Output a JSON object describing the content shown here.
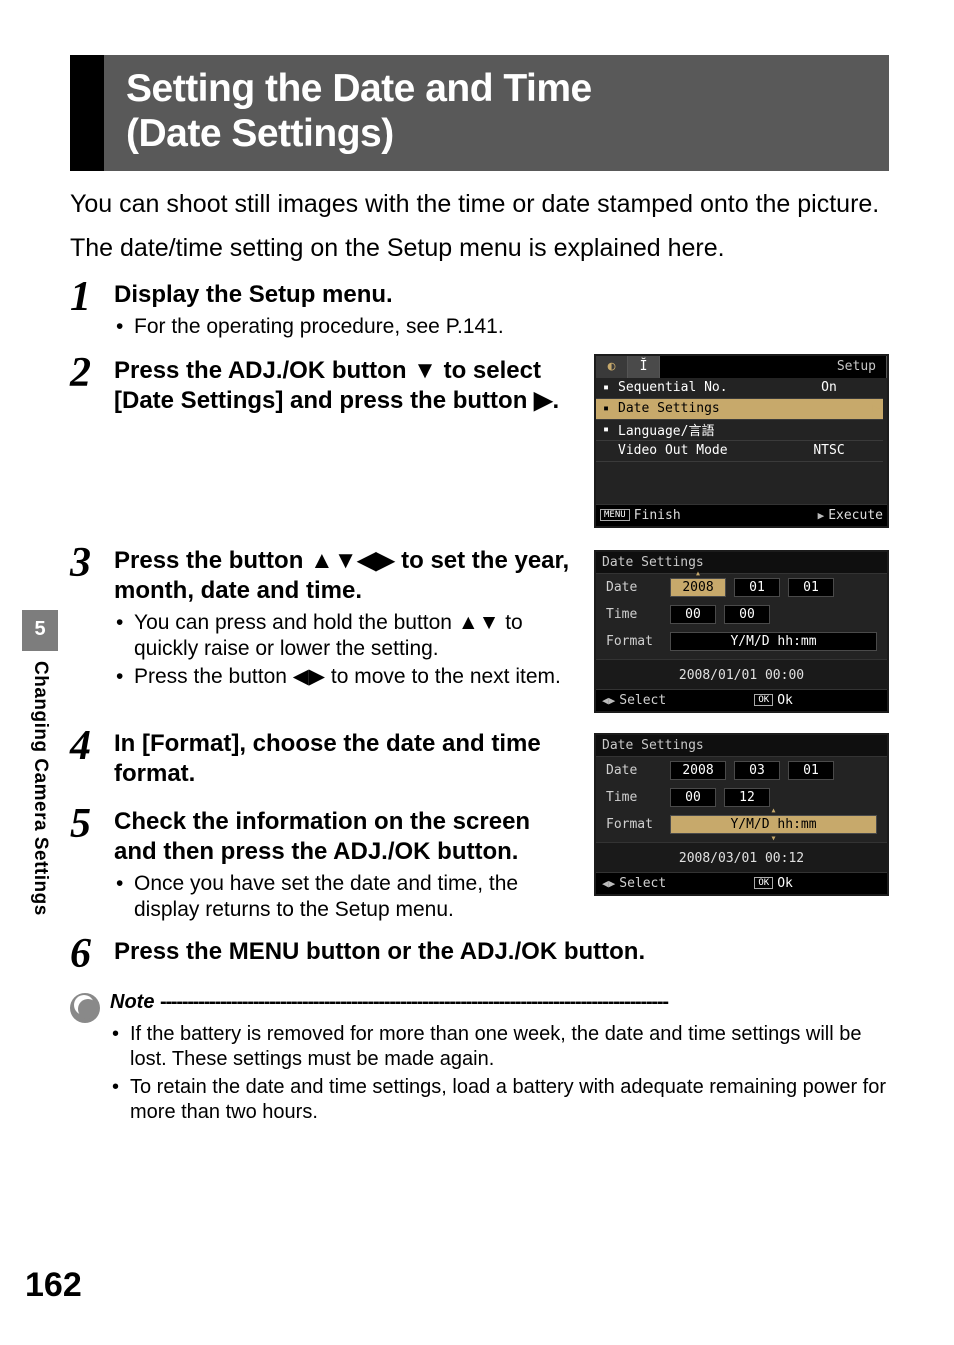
{
  "section": {
    "title_line1": "Setting the Date and Time",
    "title_line2": "(Date Settings)"
  },
  "intro": {
    "p1": "You can shoot still images with the time or date stamped onto the picture.",
    "p2": "The date/time setting on the Setup menu is explained here."
  },
  "steps": {
    "s1": {
      "num": "1",
      "title": "Display the Setup menu.",
      "b1": "For the operating procedure, see P.141."
    },
    "s2": {
      "num": "2",
      "title_a": "Press the ADJ./OK button ",
      "title_b": " to select [Date Settings] and press the button ",
      "arrow_down": "▼",
      "arrow_right": "▶",
      "period": "."
    },
    "s3": {
      "num": "3",
      "title_a": "Press the button ",
      "title_b": " to set the year, month, date and time.",
      "arrows4": "▲▼◀▶",
      "b1_a": "You can press and hold the button ",
      "b1_arrows": "▲▼",
      "b1_b": " to quickly raise or lower the setting.",
      "b2_a": "Press the button ",
      "b2_arrows": "◀▶",
      "b2_b": " to move to the next item."
    },
    "s4": {
      "num": "4",
      "title": "In [Format], choose the date and time format."
    },
    "s5": {
      "num": "5",
      "title": "Check the information on the screen and then press the ADJ./OK button.",
      "b1": "Once you have set the date and time, the display returns to the Setup menu."
    },
    "s6": {
      "num": "6",
      "title": "Press the MENU button or the ADJ./OK button."
    }
  },
  "note": {
    "label": "Note",
    "dashes": "---------------------------------------------------------------------------------------------",
    "b1": "If the battery is removed for more than one week, the date and time settings will be lost. These settings must be made again.",
    "b2": "To retain the date and time settings, load a battery with adequate remaining power for more than two hours."
  },
  "sidebar": {
    "chapter_num": "5",
    "chapter_name": "Changing Camera Settings"
  },
  "page_number": "162",
  "lcd_setup": {
    "tab_camera": "◐",
    "tab_tools": "Ĭ",
    "tab_setup": "Setup",
    "row1_name": "Sequential No.",
    "row1_val": "On",
    "row2_name": "Date Settings",
    "row2_arrow": "▷",
    "row3_name": "Language/言語",
    "row4_name": "Video Out Mode",
    "row4_val": "NTSC",
    "foot_key": "MENU",
    "foot_txt": "Finish",
    "foot_exec_arrow": "▶",
    "foot_exec": "Execute"
  },
  "lcd_ds1": {
    "title": "Date Settings",
    "date_label": "Date",
    "date_y": "2008",
    "date_m": "01",
    "date_d": "01",
    "time_label": "Time",
    "time_h": "00",
    "time_m": "00",
    "format_label": "Format",
    "format_val": "Y/M/D hh:mm",
    "preview": "2008/01/01  00:00",
    "select_arrows": "◀▶",
    "select": "Select",
    "ok_key": "OK",
    "ok_txt": "Ok"
  },
  "lcd_ds2": {
    "title": "Date Settings",
    "date_label": "Date",
    "date_y": "2008",
    "date_m": "03",
    "date_d": "01",
    "time_label": "Time",
    "time_h": "00",
    "time_m": "12",
    "format_label": "Format",
    "format_val": "Y/M/D hh:mm",
    "preview": "2008/03/01  00:12",
    "select_arrows": "◀▶",
    "select": "Select",
    "ok_key": "OK",
    "ok_txt": "Ok"
  }
}
